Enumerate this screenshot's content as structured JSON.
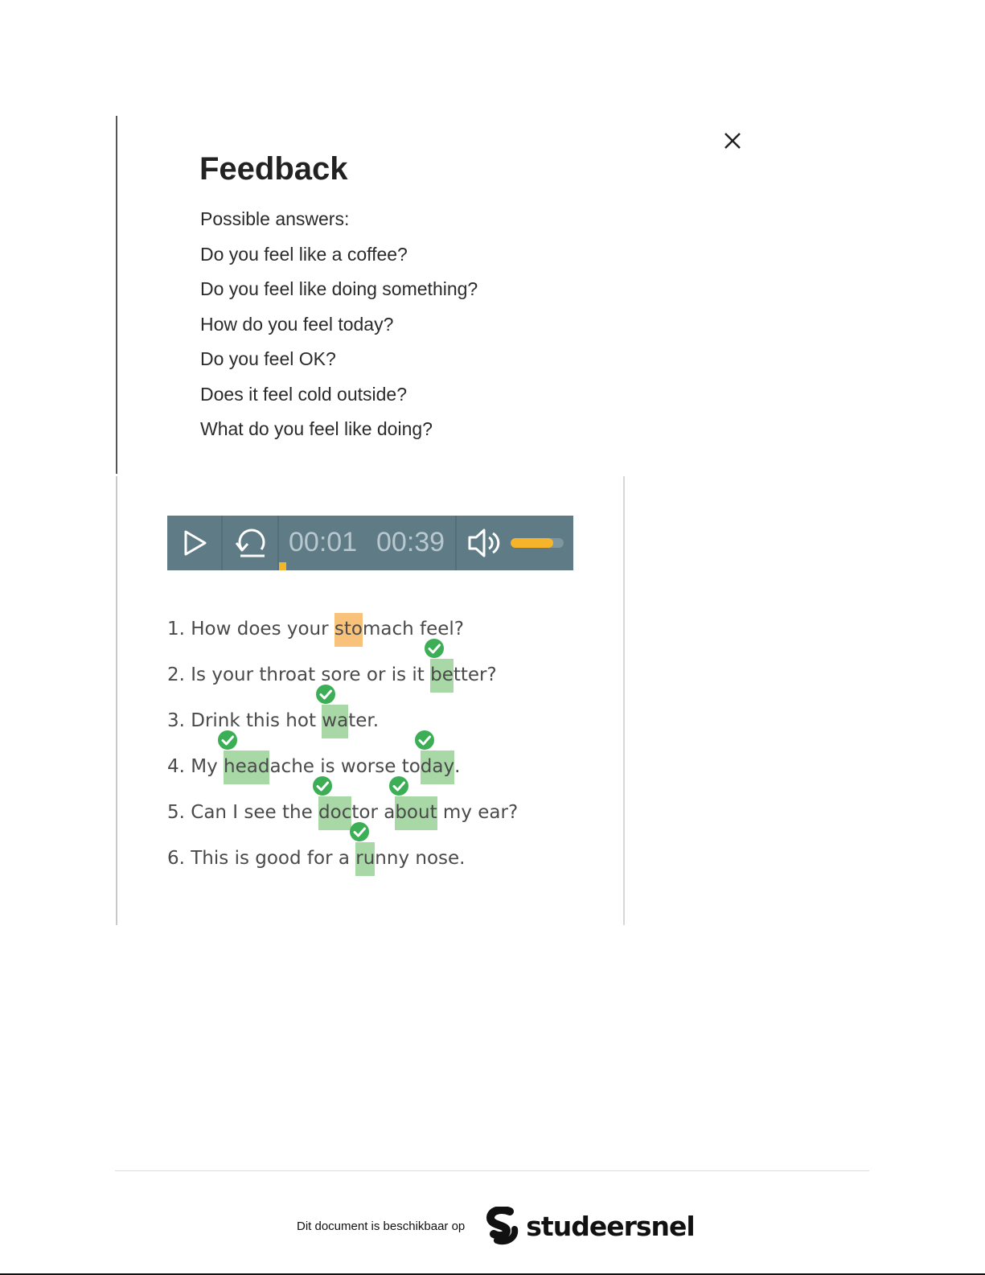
{
  "feedback": {
    "title": "Feedback",
    "intro": "Possible answers:",
    "answers": [
      "Do you feel like a coffee?",
      "Do you feel like doing something?",
      "How do you feel today?",
      "Do you feel OK?",
      "Does it feel cold outside?",
      "What do you feel like doing?"
    ]
  },
  "player": {
    "current_time": "00:01",
    "total_time": "00:39",
    "progress": 0.02,
    "volume": 0.8,
    "accent_color": "#f5b42a",
    "bar_color": "#5e7b86"
  },
  "sentences": [
    {
      "parts": [
        {
          "t": "1. How does your "
        },
        {
          "t": "sto",
          "hl": "warn"
        },
        {
          "t": "mach feel?"
        }
      ]
    },
    {
      "parts": [
        {
          "t": "2. Is your throat sore or is it "
        },
        {
          "t": "be",
          "hl": "ok",
          "check": true
        },
        {
          "t": "tter?"
        }
      ]
    },
    {
      "parts": [
        {
          "t": "3. Drink this hot "
        },
        {
          "t": "wa",
          "hl": "ok",
          "check": true
        },
        {
          "t": "ter."
        }
      ]
    },
    {
      "parts": [
        {
          "t": "4. My "
        },
        {
          "t": "head",
          "hl": "ok",
          "check": true
        },
        {
          "t": "ache is worse to"
        },
        {
          "t": "day",
          "hl": "ok",
          "check": true
        },
        {
          "t": "."
        }
      ]
    },
    {
      "parts": [
        {
          "t": "5. Can I see the "
        },
        {
          "t": "doc",
          "hl": "ok",
          "check": true
        },
        {
          "t": "tor a"
        },
        {
          "t": "bout",
          "hl": "ok",
          "check": true
        },
        {
          "t": " my ear?"
        }
      ]
    },
    {
      "parts": [
        {
          "t": "6. This is good for a "
        },
        {
          "t": "ru",
          "hl": "ok",
          "check": true
        },
        {
          "t": "nny nose."
        }
      ]
    }
  ],
  "footer": {
    "text": "Dit document is beschikbaar op",
    "brand": "studeersnel"
  }
}
